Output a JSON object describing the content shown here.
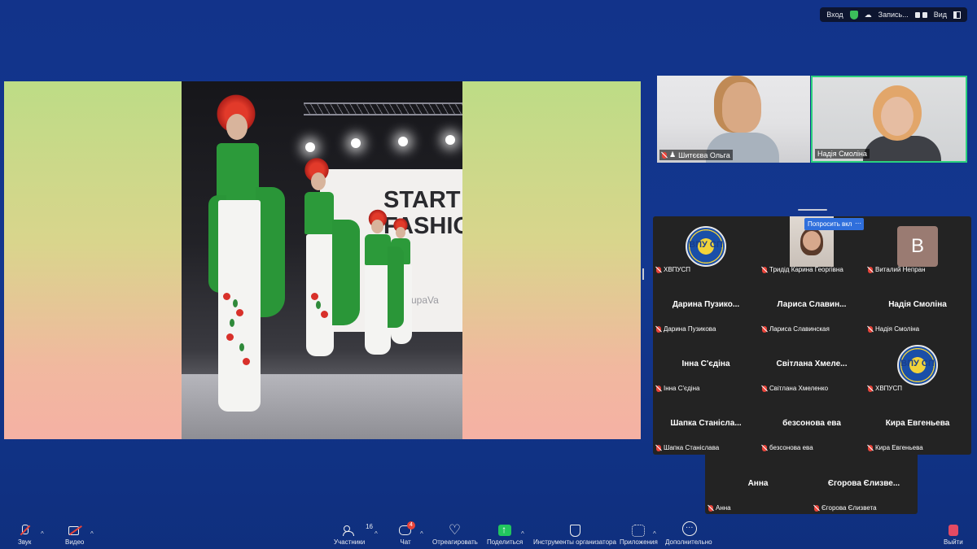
{
  "topbar": {
    "join_label": "Вход",
    "record_label": "Запись...",
    "view_label": "Вид"
  },
  "shared_screen": {
    "photo_brand_text": "START\nFASHION",
    "photo_brand_sub": "upaVa"
  },
  "videos": [
    {
      "name": "Шитєєва Ольга",
      "muted": true
    },
    {
      "name": "Надія Смоліна",
      "muted": false,
      "active_speaker": true
    }
  ],
  "gallery": {
    "ask_button": "Попросить вкл",
    "more_button": "⋯",
    "tiles": [
      {
        "center": "",
        "label": "ХВПУСП",
        "type": "logo",
        "logo_text": "ВПУ СП"
      },
      {
        "center": "",
        "label": "Тридід Карина Георгівна",
        "type": "camera"
      },
      {
        "center": "",
        "label": "Виталий Непран",
        "type": "avatar",
        "avatar_letter": "B"
      },
      {
        "center": "Дарина  Пузико...",
        "label": "Дарина Пузикова"
      },
      {
        "center": "Лариса  Славин...",
        "label": "Лариса Славинская"
      },
      {
        "center": "Надія Смоліна",
        "label": "Надія Смоліна"
      },
      {
        "center": "Інна С'єдіна",
        "label": "Інна С'єдіна"
      },
      {
        "center": "Світлана  Хмеле...",
        "label": "Світлана Хмеленко"
      },
      {
        "center": "",
        "label": "ХВПУСП",
        "type": "logo",
        "logo_text": "ВПУ СП"
      },
      {
        "center": "Шапка  Станісла...",
        "label": "Шапка Станіслава"
      },
      {
        "center": "безсонова ева",
        "label": "безсонова ева"
      },
      {
        "center": "Кира Евгеньева",
        "label": "Кира Евгеньева"
      },
      {
        "center": "Анна",
        "label": "Анна"
      },
      {
        "center": "Єгорова  Єлизве...",
        "label": "Єгорова Єлизвета"
      }
    ]
  },
  "toolbar": {
    "audio": "Звук",
    "video": "Видео",
    "participants": "Участники",
    "participants_count": "16",
    "chat": "Чат",
    "chat_badge": "4",
    "react": "Отреагировать",
    "share": "Поделиться",
    "host_tools": "Инструменты организатора",
    "apps": "Приложения",
    "more": "Дополнительно",
    "leave": "Выйти"
  },
  "colors": {
    "background": "#12338a",
    "active_speaker_border": "#2bd17e",
    "muted_mic": "#e8443a",
    "share_green": "#22c55e",
    "leave_red": "#e34a63",
    "ask_button": "#2f6fdc"
  }
}
